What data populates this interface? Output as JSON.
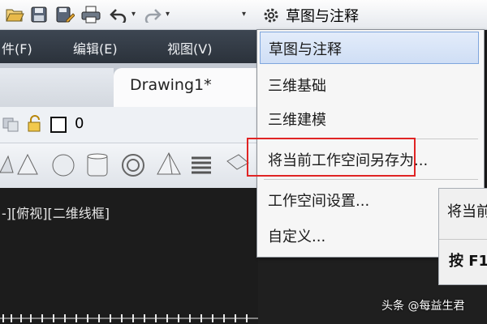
{
  "workspace": {
    "current": "草图与注释"
  },
  "menubar": {
    "items": [
      "件(F)",
      "编辑(E)",
      "视图(V)"
    ]
  },
  "tabs": {
    "drawing": "Drawing1*"
  },
  "layer": {
    "value": "0"
  },
  "viewport": {
    "label": "-][俯视][二维线框]"
  },
  "dropdown": {
    "items": [
      "草图与注释",
      "三维基础",
      "三维建模",
      "将当前工作空间另存为...",
      "工作空间设置...",
      "自定义..."
    ]
  },
  "tooltip": {
    "line1": "将当前",
    "line2": "按 F1"
  },
  "watermark": "头条 @每益生君",
  "colors": {
    "highlight_border": "#e02424",
    "menu_bg": "#2f3640",
    "selected_item_bg": "#d6e4f7"
  }
}
